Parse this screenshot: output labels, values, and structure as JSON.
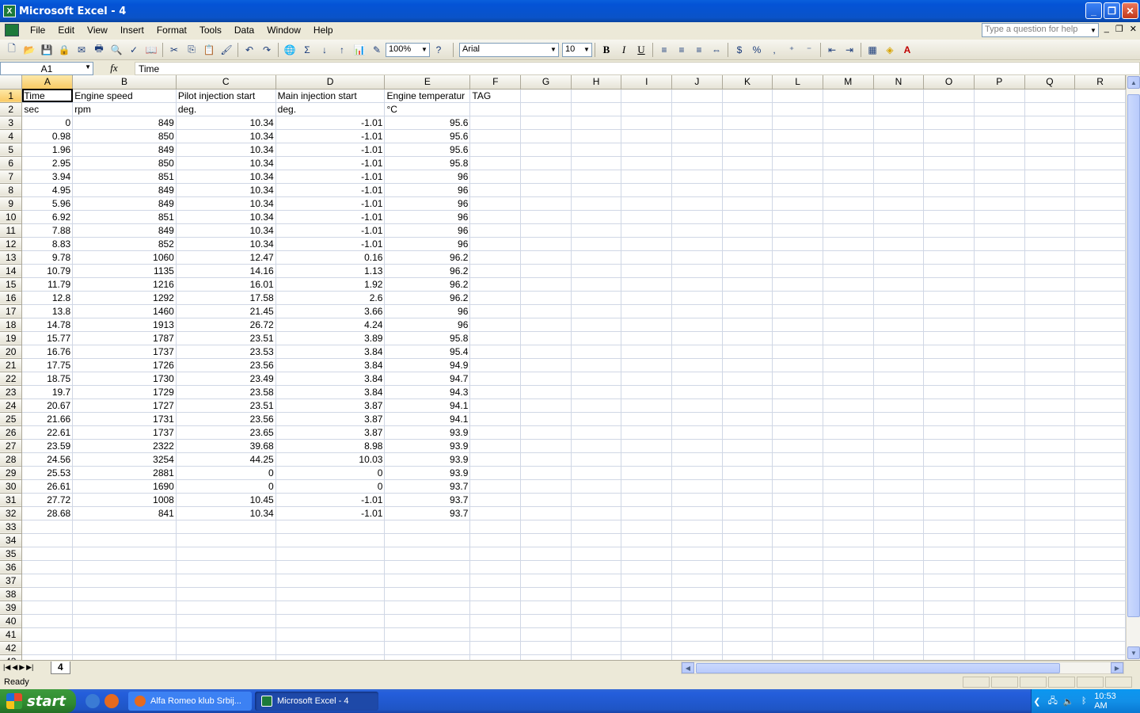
{
  "window": {
    "title": "Microsoft Excel - 4"
  },
  "menu": [
    "File",
    "Edit",
    "View",
    "Insert",
    "Format",
    "Tools",
    "Data",
    "Window",
    "Help"
  ],
  "help_placeholder": "Type a question for help",
  "toolbar": {
    "zoom": "100%",
    "font": "Arial",
    "size": "10",
    "bold": "B",
    "italic": "I",
    "underline": "U",
    "currency": "$",
    "percent": "%",
    "comma": ","
  },
  "formula_bar": {
    "name_box": "A1",
    "fx": "fx",
    "content": "Time"
  },
  "columns": [
    "A",
    "B",
    "C",
    "D",
    "E",
    "F",
    "G",
    "H",
    "I",
    "J",
    "K",
    "L",
    "M",
    "N",
    "O",
    "P",
    "Q",
    "R"
  ],
  "header_row": [
    "Time",
    "Engine speed",
    "Pilot injection start",
    "Main injection start",
    "Engine temperatur",
    "TAG"
  ],
  "units_row": [
    "sec",
    "rpm",
    "deg.",
    "deg.",
    "°C"
  ],
  "data_rows": [
    [
      "0",
      "849",
      "10.34",
      "-1.01",
      "95.6"
    ],
    [
      "0.98",
      "850",
      "10.34",
      "-1.01",
      "95.6"
    ],
    [
      "1.96",
      "849",
      "10.34",
      "-1.01",
      "95.6"
    ],
    [
      "2.95",
      "850",
      "10.34",
      "-1.01",
      "95.8"
    ],
    [
      "3.94",
      "851",
      "10.34",
      "-1.01",
      "96"
    ],
    [
      "4.95",
      "849",
      "10.34",
      "-1.01",
      "96"
    ],
    [
      "5.96",
      "849",
      "10.34",
      "-1.01",
      "96"
    ],
    [
      "6.92",
      "851",
      "10.34",
      "-1.01",
      "96"
    ],
    [
      "7.88",
      "849",
      "10.34",
      "-1.01",
      "96"
    ],
    [
      "8.83",
      "852",
      "10.34",
      "-1.01",
      "96"
    ],
    [
      "9.78",
      "1060",
      "12.47",
      "0.16",
      "96.2"
    ],
    [
      "10.79",
      "1135",
      "14.16",
      "1.13",
      "96.2"
    ],
    [
      "11.79",
      "1216",
      "16.01",
      "1.92",
      "96.2"
    ],
    [
      "12.8",
      "1292",
      "17.58",
      "2.6",
      "96.2"
    ],
    [
      "13.8",
      "1460",
      "21.45",
      "3.66",
      "96"
    ],
    [
      "14.78",
      "1913",
      "26.72",
      "4.24",
      "96"
    ],
    [
      "15.77",
      "1787",
      "23.51",
      "3.89",
      "95.8"
    ],
    [
      "16.76",
      "1737",
      "23.53",
      "3.84",
      "95.4"
    ],
    [
      "17.75",
      "1726",
      "23.56",
      "3.84",
      "94.9"
    ],
    [
      "18.75",
      "1730",
      "23.49",
      "3.84",
      "94.7"
    ],
    [
      "19.7",
      "1729",
      "23.58",
      "3.84",
      "94.3"
    ],
    [
      "20.67",
      "1727",
      "23.51",
      "3.87",
      "94.1"
    ],
    [
      "21.66",
      "1731",
      "23.56",
      "3.87",
      "94.1"
    ],
    [
      "22.61",
      "1737",
      "23.65",
      "3.87",
      "93.9"
    ],
    [
      "23.59",
      "2322",
      "39.68",
      "8.98",
      "93.9"
    ],
    [
      "24.56",
      "3254",
      "44.25",
      "10.03",
      "93.9"
    ],
    [
      "25.53",
      "2881",
      "0",
      "0",
      "93.9"
    ],
    [
      "26.61",
      "1690",
      "0",
      "0",
      "93.7"
    ],
    [
      "27.72",
      "1008",
      "10.45",
      "-1.01",
      "93.7"
    ],
    [
      "28.68",
      "841",
      "10.34",
      "-1.01",
      "93.7"
    ]
  ],
  "total_rows": 43,
  "sheet_tab": "4",
  "status": "Ready",
  "taskbar": {
    "start": "start",
    "tasks": [
      "Alfa Romeo klub Srbij...",
      "Microsoft Excel - 4"
    ],
    "clock": "10:53 AM"
  }
}
